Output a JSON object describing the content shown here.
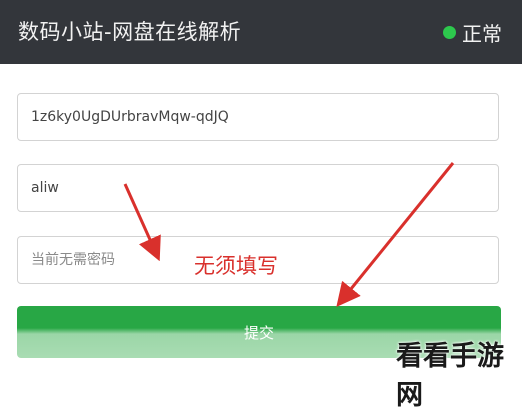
{
  "header": {
    "title": "数码小站-网盘在线解析",
    "status_text": "正常",
    "status_color": "#2dc84d"
  },
  "form": {
    "link_value": "1z6ky0UgDUrbravMqw-qdJQ",
    "code_value": "aliw",
    "password_placeholder": "当前无需密码",
    "submit_label": "提交"
  },
  "annotation": {
    "text": "无须填写",
    "color": "#d9302c"
  },
  "watermark": {
    "text": "看看手游网"
  }
}
